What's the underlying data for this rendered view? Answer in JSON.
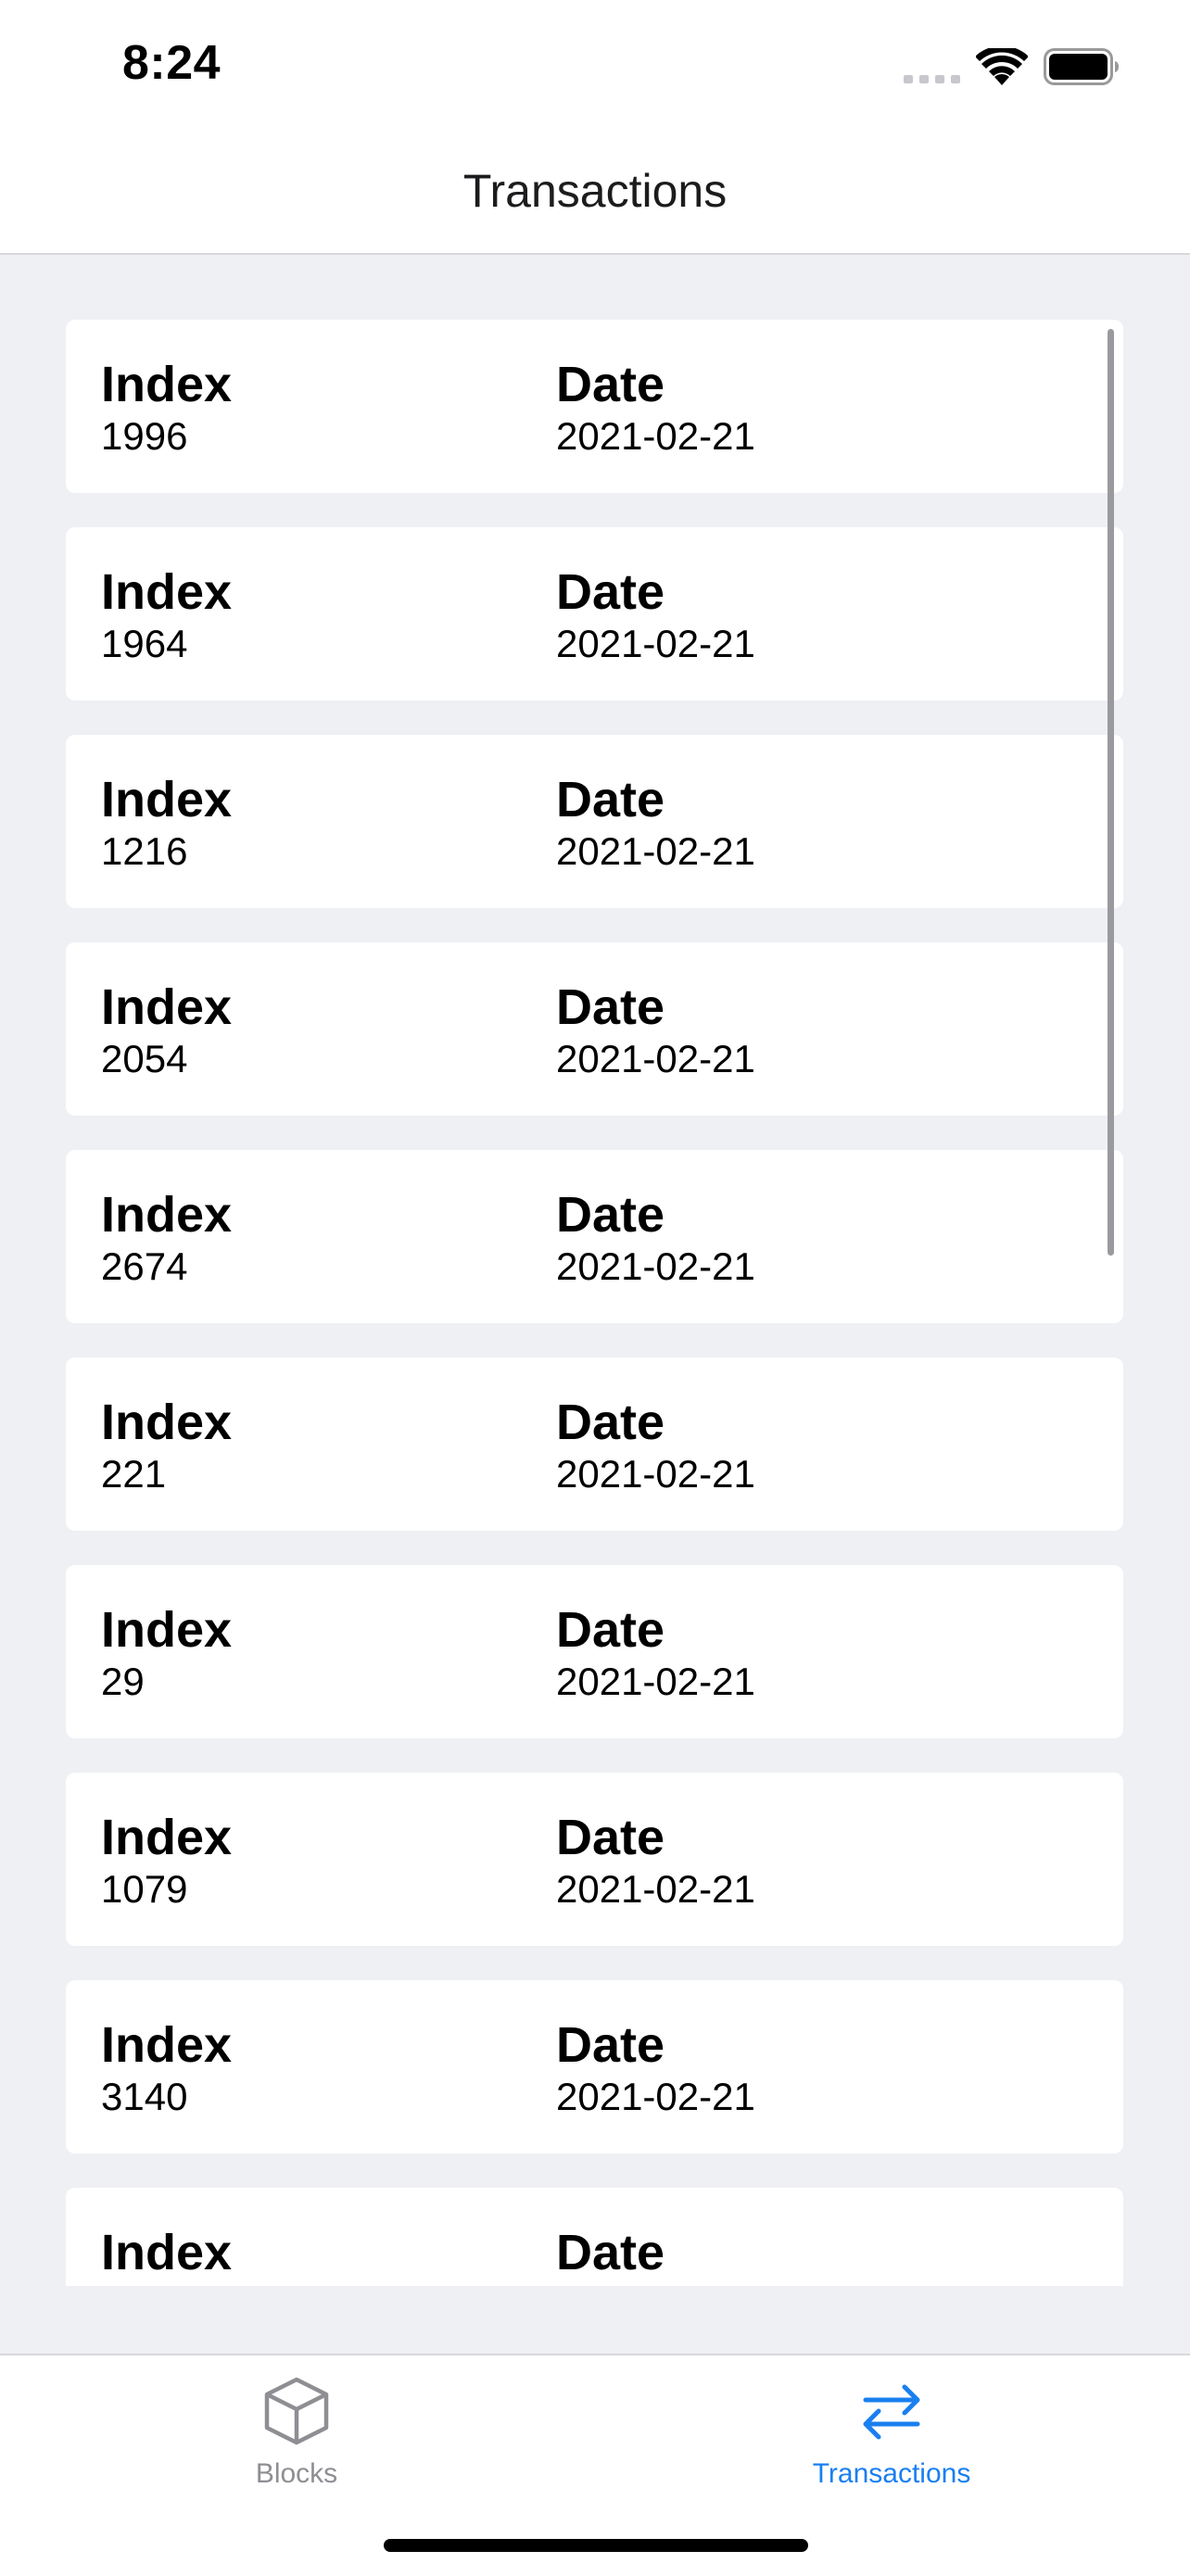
{
  "status_bar": {
    "time": "8:24"
  },
  "nav": {
    "title": "Transactions"
  },
  "transactions": [
    {
      "index_label": "Index",
      "index": "1996",
      "date_label": "Date",
      "date": "2021-02-21"
    },
    {
      "index_label": "Index",
      "index": "1964",
      "date_label": "Date",
      "date": "2021-02-21"
    },
    {
      "index_label": "Index",
      "index": "1216",
      "date_label": "Date",
      "date": "2021-02-21"
    },
    {
      "index_label": "Index",
      "index": "2054",
      "date_label": "Date",
      "date": "2021-02-21"
    },
    {
      "index_label": "Index",
      "index": "2674",
      "date_label": "Date",
      "date": "2021-02-21"
    },
    {
      "index_label": "Index",
      "index": "221",
      "date_label": "Date",
      "date": "2021-02-21"
    },
    {
      "index_label": "Index",
      "index": "29",
      "date_label": "Date",
      "date": "2021-02-21"
    },
    {
      "index_label": "Index",
      "index": "1079",
      "date_label": "Date",
      "date": "2021-02-21"
    },
    {
      "index_label": "Index",
      "index": "3140",
      "date_label": "Date",
      "date": "2021-02-21"
    },
    {
      "index_label": "Index",
      "index": "",
      "date_label": "Date",
      "date": ""
    }
  ],
  "tab_bar": {
    "tabs": [
      {
        "label": "Blocks",
        "icon": "cube-icon",
        "selected": false
      },
      {
        "label": "Transactions",
        "icon": "arrows-left-right-icon",
        "selected": true
      }
    ]
  },
  "colors": {
    "accent": "#1a7ff0",
    "inactive": "#8e8e93",
    "background": "#eff0f4"
  }
}
